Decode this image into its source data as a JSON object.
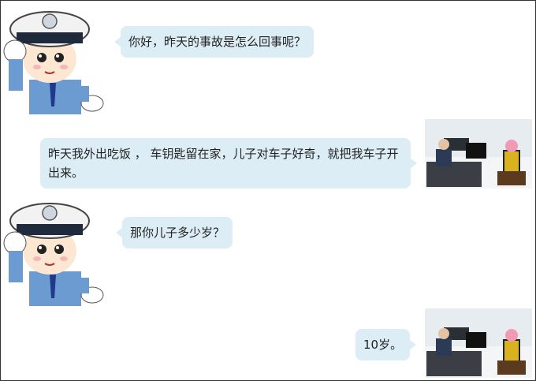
{
  "conversation": {
    "messages": [
      {
        "side": "left",
        "speaker": "police-officer",
        "text": "你好，昨天的事故是怎么回事呢？"
      },
      {
        "side": "right",
        "speaker": "parent",
        "text": "昨天我外出吃饭 ， 车钥匙留在家，儿子对车子好奇，就把我车子开出来。"
      },
      {
        "side": "left",
        "speaker": "police-officer",
        "text": "那你儿子多少岁？"
      },
      {
        "side": "right",
        "speaker": "parent",
        "text": "10岁。"
      }
    ]
  },
  "avatars": {
    "officer_icon": "cartoon-police-officer-saluting",
    "parent_icon": "police-station-interview-photo"
  },
  "colors": {
    "bubble": "#dcedf5",
    "text": "#222222",
    "officer_uniform": "#6b9bd1",
    "officer_cap": "#1f2a3c"
  }
}
